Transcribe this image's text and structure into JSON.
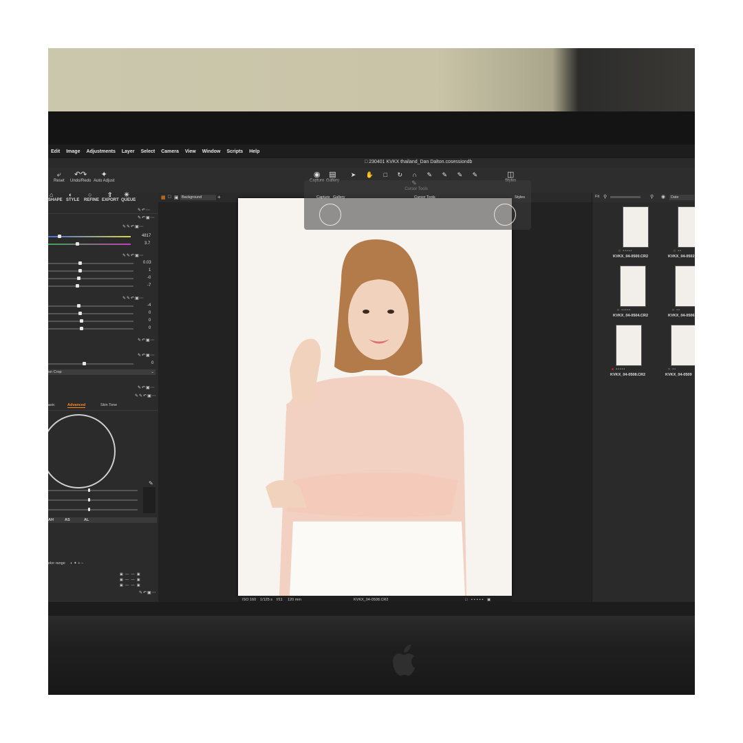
{
  "menu": [
    "Edit",
    "Image",
    "Adjustments",
    "Layer",
    "Select",
    "Camera",
    "View",
    "Window",
    "Scripts",
    "Help"
  ],
  "window_title": "230401 KVKX thailand_Dan Dalton.cosessiondb",
  "toolbar": {
    "reset": "Reset",
    "undo_redo": "Undo/Redo",
    "auto_adjust": "Auto Adjust",
    "capture": "Capture",
    "gallery": "Gallery",
    "cursor_tools": "Cursor Tools",
    "styles": "Styles"
  },
  "left_tabs": [
    "SHAPE",
    "STYLE",
    "REFINE",
    "EXPORT",
    "QUEUE"
  ],
  "left_values": [
    "4817",
    "3.7",
    "0.03",
    "1",
    "-0",
    "-7",
    "-4",
    "0",
    "0",
    "0",
    "0"
  ],
  "crop_label": "on Crop",
  "color_tabs": {
    "basic": "asic",
    "advanced": "Advanced",
    "skin_tone": "Skin Tone"
  },
  "color_range_label": "olor range",
  "zone_labels": [
    "AH",
    "AS",
    "AL"
  ],
  "view": {
    "background": "Background"
  },
  "image_meta": {
    "iso": "ISO 160",
    "shutter": "1/125 s",
    "aperture": "f/11",
    "focal": "120 mm",
    "filename": "KVKX_04-0508.CR2"
  },
  "browser": {
    "fit": "Fit",
    "sort": "Date"
  },
  "thumbnails": [
    {
      "label": "KVKX_04-0500.CR2"
    },
    {
      "label": "KVKX_04-0502"
    },
    {
      "label": "KVKX_04-0504.CR2"
    },
    {
      "label": "KVKX_04-0506"
    },
    {
      "label": "KVKX_04-0508.CR2"
    },
    {
      "label": "KVKX_04-0509"
    }
  ],
  "colors": {
    "accent": "#ff8a1c",
    "panel": "#2b2b2b",
    "screen": "#262626",
    "wall": "#cbc7ad"
  }
}
